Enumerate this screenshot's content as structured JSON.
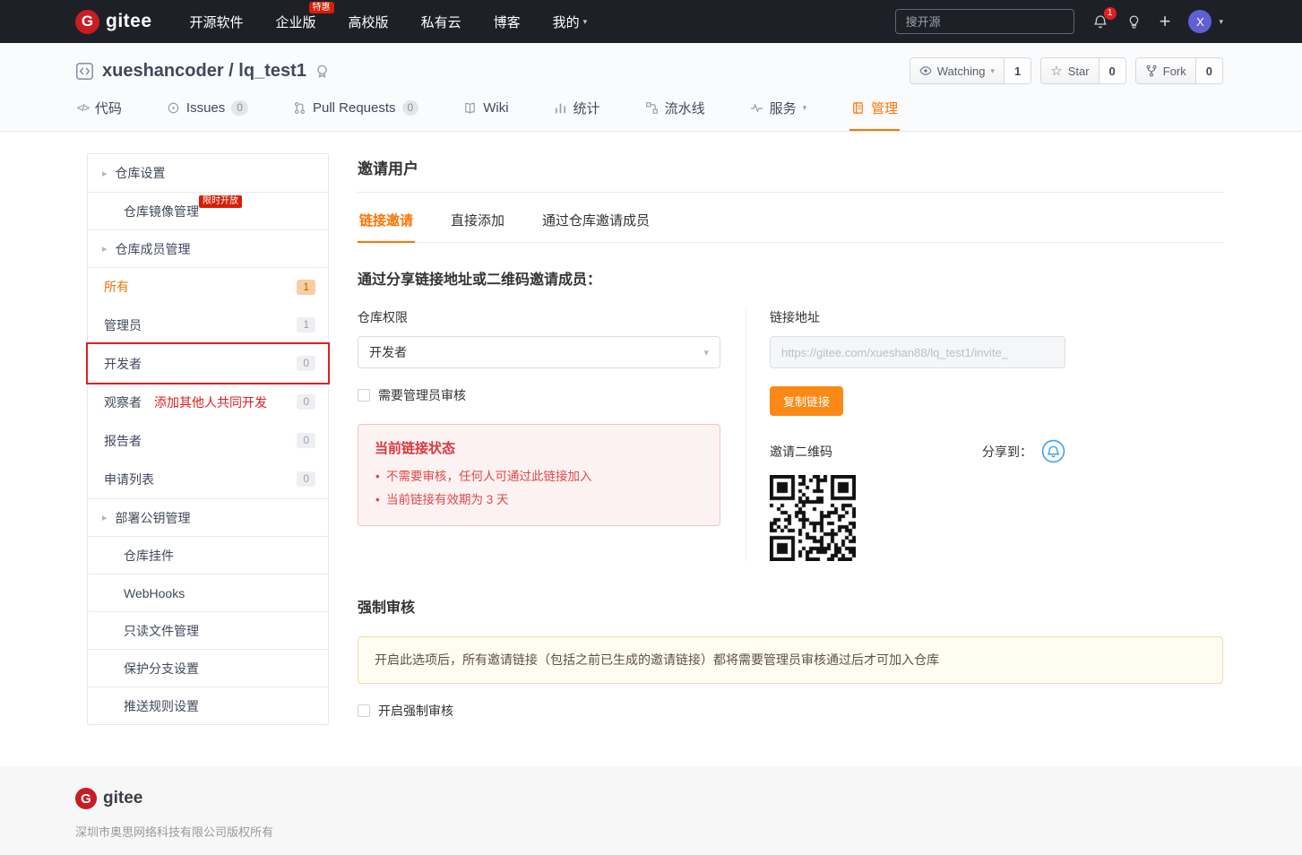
{
  "colors": {
    "accent": "#fe7300",
    "brand_red": "#c71d23",
    "danger": "#e02020"
  },
  "navbar": {
    "brand": "gitee",
    "items": [
      {
        "label": "开源软件"
      },
      {
        "label": "企业版",
        "badge": "特惠"
      },
      {
        "label": "高校版"
      },
      {
        "label": "私有云"
      },
      {
        "label": "博客"
      },
      {
        "label": "我的"
      }
    ],
    "search_placeholder": "搜开源",
    "notification_count": "1",
    "avatar_letter": "X"
  },
  "repo": {
    "title": "xueshancoder / lq_test1",
    "watching_label": "Watching",
    "watching_count": "1",
    "star_label": "Star",
    "star_count": "0",
    "fork_label": "Fork",
    "fork_count": "0",
    "tabs": [
      {
        "label": "代码"
      },
      {
        "label": "Issues",
        "count": "0"
      },
      {
        "label": "Pull Requests",
        "count": "0"
      },
      {
        "label": "Wiki"
      },
      {
        "label": "统计"
      },
      {
        "label": "流水线"
      },
      {
        "label": "服务"
      },
      {
        "label": "管理"
      }
    ]
  },
  "sidebar": {
    "items": [
      {
        "label": "仓库设置"
      },
      {
        "label": "仓库镜像管理",
        "badge": "限时开放"
      },
      {
        "label": "仓库成员管理"
      },
      {
        "label": "所有",
        "count": "1"
      },
      {
        "label": "管理员",
        "count": "1"
      },
      {
        "label": "开发者",
        "count": "0"
      },
      {
        "label": "观察者",
        "count": "0",
        "annotation": "添加其他人共同开发"
      },
      {
        "label": "报告者",
        "count": "0"
      },
      {
        "label": "申请列表",
        "count": "0"
      },
      {
        "label": "部署公钥管理"
      },
      {
        "label": "仓库挂件"
      },
      {
        "label": "WebHooks"
      },
      {
        "label": "只读文件管理"
      },
      {
        "label": "保护分支设置"
      },
      {
        "label": "推送规则设置"
      }
    ]
  },
  "main": {
    "page_title": "邀请用户",
    "tabs": [
      {
        "label": "链接邀请"
      },
      {
        "label": "直接添加"
      },
      {
        "label": "通过仓库邀请成员"
      }
    ],
    "section_title": "通过分享链接地址或二维码邀请成员：",
    "permission_label": "仓库权限",
    "permission_value": "开发者",
    "review_checkbox": "需要管理员审核",
    "status": {
      "title": "当前链接状态",
      "items": [
        "不需要审核，任何人可通过此链接加入",
        "当前链接有效期为 3 天"
      ]
    },
    "link_label": "链接地址",
    "link_placeholder": "https://gitee.com/xueshan88/lq_test1/invite_",
    "copy_button": "复制链接",
    "qr_label": "邀请二维码",
    "share_label": "分享到：",
    "force": {
      "title": "强制审核",
      "notice": "开启此选项后，所有邀请链接（包括之前已生成的邀请链接）都将需要管理员审核通过后才可加入仓库",
      "checkbox": "开启强制审核"
    }
  },
  "footer": {
    "brand": "gitee",
    "copyright": "深圳市奥思网络科技有限公司版权所有"
  }
}
